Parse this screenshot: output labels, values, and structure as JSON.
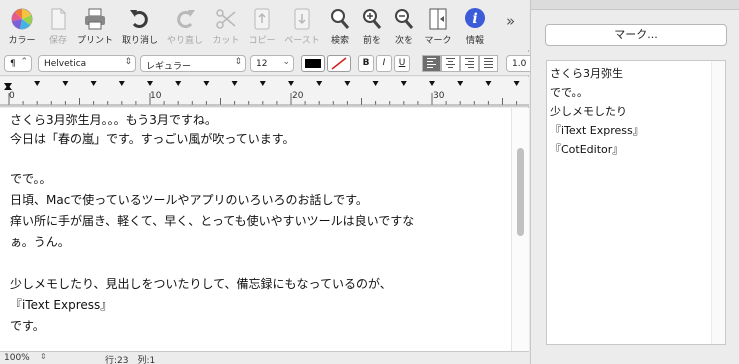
{
  "toolbar": {
    "items": [
      {
        "label": "カラー",
        "icon": "color-wheel-icon",
        "enabled": true
      },
      {
        "label": "保存",
        "icon": "save-icon",
        "enabled": false
      },
      {
        "label": "プリント",
        "icon": "printer-icon",
        "enabled": true
      },
      {
        "label": "取り消し",
        "icon": "undo-icon",
        "enabled": true
      },
      {
        "label": "やり直し",
        "icon": "redo-icon",
        "enabled": false
      },
      {
        "label": "カット",
        "icon": "scissors-icon",
        "enabled": false
      },
      {
        "label": "コピー",
        "icon": "copy-icon",
        "enabled": false
      },
      {
        "label": "ペースト",
        "icon": "paste-icon",
        "enabled": false
      },
      {
        "label": "検索",
        "icon": "magnifier-icon",
        "enabled": true
      },
      {
        "label": "前を",
        "icon": "find-previous-icon",
        "enabled": true
      },
      {
        "label": "次を",
        "icon": "find-next-icon",
        "enabled": true
      },
      {
        "label": "マーク",
        "icon": "mark-icon",
        "enabled": true
      },
      {
        "label": "情報",
        "icon": "info-icon",
        "enabled": true
      }
    ],
    "more": "»"
  },
  "format": {
    "paragraph": "¶",
    "font_family": "Helvetica",
    "font_style": "レギュラー",
    "font_size": "12",
    "bold": "B",
    "italic": "I",
    "underline": "U",
    "line_spacing": "1.0",
    "text_color": "#000000"
  },
  "ruler": {
    "marks": [
      "0",
      "10",
      "20",
      "30"
    ]
  },
  "document": {
    "lines": [
      "さくら3月弥生月。。。もう3月ですね。",
      "今日は「春の嵐」です。すっごい風が吹っています。",
      "",
      "でで。。",
      "日頃、Macで使っているツールやアプリのいろいろのお話しです。",
      "痒い所に手が届き、軽くて、早く、とっても使いやすいツールは良いですな",
      "ぁ。うん。",
      "",
      "少しメモしたり、見出しをついたりして、備忘録にもなっているのが、",
      "『iText Express』",
      "です。"
    ]
  },
  "status": {
    "zoom": "100%",
    "position": "行:23　列:1"
  },
  "marks_panel": {
    "button": "マーク...",
    "items": [
      "さくら3月弥生",
      "でで。。",
      "少しメモしたり",
      "『iText Express』",
      "『CotEditor』"
    ]
  }
}
